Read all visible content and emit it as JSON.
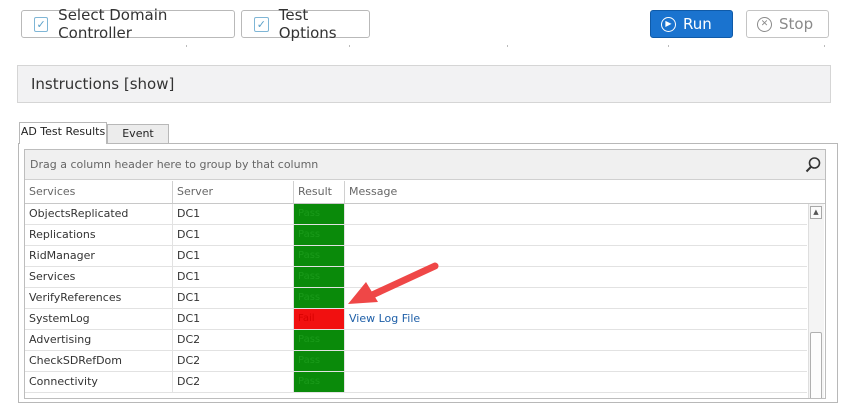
{
  "toolbar": {
    "select_dc_label": "Select Domain Controller",
    "test_options_label": "Test Options",
    "run_label": "Run",
    "stop_label": "Stop"
  },
  "instructions": {
    "label": "Instructions [show]"
  },
  "tabs": [
    {
      "label": "AD Test Results",
      "active": true
    },
    {
      "label": "Event Logs",
      "active": false
    }
  ],
  "grid": {
    "group_hint": "Drag a column header here to group by that column",
    "columns": [
      "Services",
      "Server",
      "Result",
      "Message"
    ],
    "rows": [
      {
        "service": "ObjectsReplicated",
        "server": "DC1",
        "result": "Pass",
        "message": ""
      },
      {
        "service": "Replications",
        "server": "DC1",
        "result": "Pass",
        "message": ""
      },
      {
        "service": "RidManager",
        "server": "DC1",
        "result": "Pass",
        "message": ""
      },
      {
        "service": "Services",
        "server": "DC1",
        "result": "Pass",
        "message": ""
      },
      {
        "service": "VerifyReferences",
        "server": "DC1",
        "result": "Pass",
        "message": ""
      },
      {
        "service": "SystemLog",
        "server": "DC1",
        "result": "Fail",
        "message": "View Log File"
      },
      {
        "service": "Advertising",
        "server": "DC2",
        "result": "Pass",
        "message": ""
      },
      {
        "service": "CheckSDRefDom",
        "server": "DC2",
        "result": "Pass",
        "message": ""
      },
      {
        "service": "Connectivity",
        "server": "DC2",
        "result": "Pass",
        "message": ""
      }
    ]
  },
  "colors": {
    "pass": "#0a8a0a",
    "fail": "#f11010",
    "run_button": "#1a73cf",
    "annotation_arrow": "#ef4747"
  },
  "icons": {
    "select_dc": "checkbox-icon",
    "test_options": "checkbox-icon",
    "run": "play-circle-icon",
    "stop": "close-circle-icon",
    "search": "search-icon"
  }
}
